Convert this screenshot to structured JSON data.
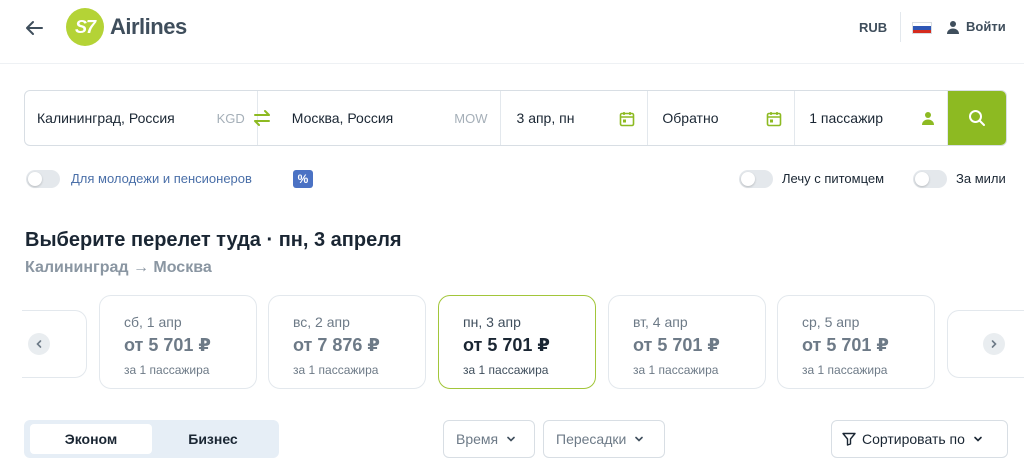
{
  "header": {
    "logo_mark": "S7",
    "logo_text": "Airlines",
    "currency": "RUB",
    "login_label": "Войти"
  },
  "search": {
    "from_city": "Калининград, Россия",
    "from_code": "KGD",
    "to_city": "Москва, Россия",
    "to_code": "MOW",
    "depart_date": "3 апр, пн",
    "return_label": "Обратно",
    "passengers": "1 пассажир"
  },
  "toggles": {
    "youth_label": "Для молодежи и пенсионеров",
    "youth_badge": "%",
    "pet_label": "Лечу с питомцем",
    "miles_label": "За мили"
  },
  "heading": {
    "title": "Выберите перелет туда · пн, 3 апреля",
    "route": "Калининград → Москва"
  },
  "dates": [
    {
      "day": "сб, 1 апр",
      "price": "от 5 701 ₽",
      "note": "за 1 пассажира"
    },
    {
      "day": "вс, 2 апр",
      "price": "от 7 876 ₽",
      "note": "за 1 пассажира"
    },
    {
      "day": "пн, 3 апр",
      "price": "от 5 701 ₽",
      "note": "за 1 пассажира"
    },
    {
      "day": "вт, 4 апр",
      "price": "от 5 701 ₽",
      "note": "за 1 пассажира"
    },
    {
      "day": "ср, 5 апр",
      "price": "от 5 701 ₽",
      "note": "за 1 пассажира"
    }
  ],
  "controls": {
    "economy": "Эконом",
    "business": "Бизнес",
    "time": "Время",
    "transfers": "Пересадки",
    "sort": "Сортировать по"
  },
  "colors": {
    "brand": "#b4d336",
    "accent_button": "#8dba22",
    "selected_border": "#a2c63a",
    "badge": "#4b72c4"
  }
}
